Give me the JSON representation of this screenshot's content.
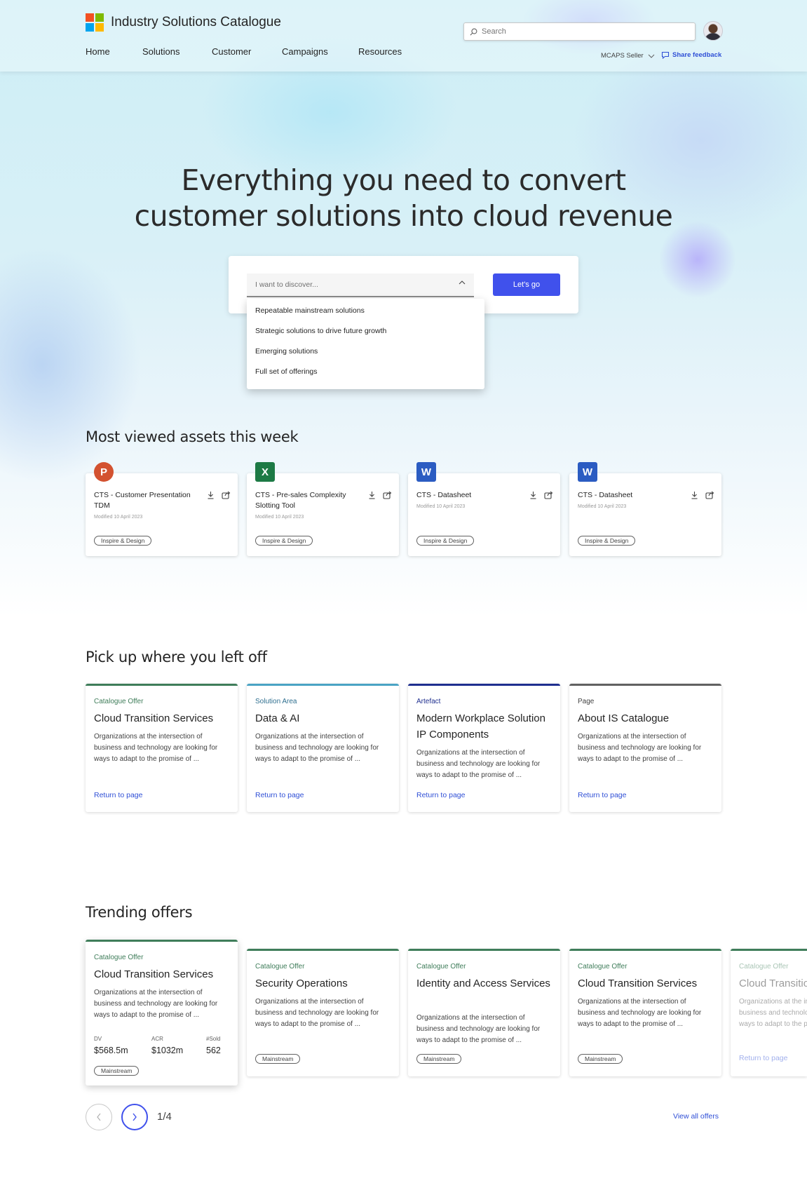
{
  "header": {
    "app_title": "Industry Solutions Catalogue",
    "nav": [
      "Home",
      "Solutions",
      "Customer",
      "Campaigns",
      "Resources"
    ],
    "search_placeholder": "Search",
    "role": "MCAPS Seller",
    "feedback": "Share feedback",
    "logo_colors": [
      "#f25022",
      "#7fba00",
      "#00a4ef",
      "#ffb900"
    ]
  },
  "hero": {
    "title_line1": "Everything you need to convert",
    "title_line2": "customer solutions into cloud revenue",
    "dropdown_placeholder": "I want to discover...",
    "button": "Let's go",
    "options": [
      "Repeatable mainstream solutions",
      "Strategic solutions to drive future growth",
      "Emerging solutions",
      "Full set of offerings"
    ]
  },
  "most_viewed": {
    "title": "Most viewed assets this week",
    "items": [
      {
        "name": "CTS - Customer Presentation TDM",
        "modified": "Modified 10 April 2023",
        "tag": "Inspire & Design",
        "icon": "powerpoint-icon",
        "letter": "P"
      },
      {
        "name": "CTS - Pre-sales Complexity Slotting Tool",
        "modified": "Modified 10 April 2023",
        "tag": "Inspire & Design",
        "icon": "excel-icon",
        "letter": "X"
      },
      {
        "name": "CTS - Datasheet",
        "modified": "Modified 10 April 2023",
        "tag": "Inspire & Design",
        "icon": "word-icon",
        "letter": "W"
      },
      {
        "name": "CTS - Datasheet",
        "modified": "Modified 10 April 2023",
        "tag": "Inspire & Design",
        "icon": "word-icon",
        "letter": "W"
      }
    ]
  },
  "pick_up": {
    "title": "Pick up where you left off",
    "items": [
      {
        "type": "Catalogue Offer",
        "title": "Cloud Transition Services",
        "desc": "Organizations at the intersection of business and technology are looking for ways to adapt to the promise of ...",
        "link": "Return to page",
        "accent": "#3f7d5a"
      },
      {
        "type": "Solution Area",
        "title": "Data & AI",
        "desc": "Organizations at the intersection of business and technology are looking for ways to adapt to the promise of ...",
        "link": "Return to page",
        "accent": "#4aa3c4"
      },
      {
        "type": "Artefact",
        "title": "Modern Workplace Solution IP Components",
        "desc": "Organizations at the intersection of business and technology are looking for ways to adapt to the promise of ...",
        "link": "Return to page",
        "accent": "#1f2f8f"
      },
      {
        "type": "Page",
        "title": "About IS Catalogue",
        "desc": "Organizations at the intersection of business and technology are looking for ways to adapt to the promise of ...",
        "link": "Return to page",
        "accent": "#616161"
      }
    ]
  },
  "trending": {
    "title": "Trending offers",
    "items": [
      {
        "type": "Catalogue Offer",
        "title": "Cloud Transition Services",
        "desc": "Organizations at the intersection of business and technology are looking for ways to adapt to the promise of ...",
        "tag": "Mainstream",
        "stats": [
          {
            "label": "DV",
            "value": "$568.5m"
          },
          {
            "label": "ACR",
            "value": "$1032m"
          },
          {
            "label": "#Sold",
            "value": "562"
          }
        ]
      },
      {
        "type": "Catalogue Offer",
        "title": "Security Operations",
        "desc": "Organizations at the intersection of business and technology are looking for ways to adapt to the promise of ...",
        "tag": "Mainstream"
      },
      {
        "type": "Catalogue Offer",
        "title": "Identity and Access Services",
        "desc": "Organizations at the intersection of business and technology are looking for ways to adapt to the promise of ...",
        "tag": "Mainstream"
      },
      {
        "type": "Catalogue Offer",
        "title": "Cloud Transition Services",
        "desc": "Organizations at the intersection of business and technology are looking for ways to adapt to the promise of ...",
        "tag": "Mainstream"
      },
      {
        "type": "Catalogue Offer",
        "title": "Cloud Transition Services",
        "desc": "Organizations at the intersection of business and technology are looking for ways to adapt to the promise of ...",
        "link": "Return to page"
      }
    ],
    "accent": "#3f7d5a",
    "pager": "1/4",
    "view_all": "View all offers"
  }
}
